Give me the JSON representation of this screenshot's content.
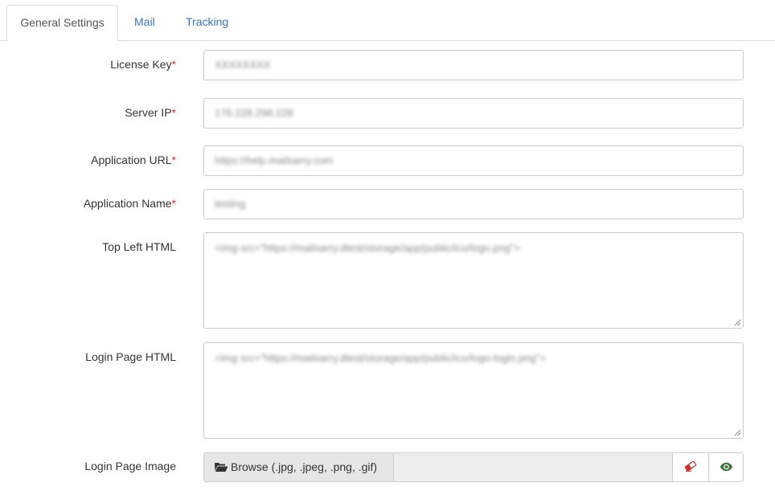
{
  "tabs": [
    {
      "label": "General Settings",
      "active": true
    },
    {
      "label": "Mail",
      "active": false
    },
    {
      "label": "Tracking",
      "active": false
    }
  ],
  "fields": {
    "license_key": {
      "label": "License Key",
      "required": "*",
      "value": "XXXXXXXX"
    },
    "server_ip": {
      "label": "Server IP",
      "required": "*",
      "value": "176.228.298.228"
    },
    "application_url": {
      "label": "Application URL",
      "required": "*",
      "value": "https://help.mailsarry.com"
    },
    "application_name": {
      "label": "Application Name",
      "required": "*",
      "value": "testing"
    },
    "top_left_html": {
      "label": "Top Left HTML",
      "value": "<img src=\"https://mailsarry.dtest/storage/app/public/ico/logo.png\">"
    },
    "login_page_html": {
      "label": "Login Page HTML",
      "value": "<img src=\"https://mailsarry.dtest/storage/app/public/ico/logo-login.png\">"
    },
    "login_page_image": {
      "label": "Login Page Image",
      "browse_label": "Browse (.jpg, .jpeg, .png, .gif)"
    }
  },
  "icons": {
    "browse": "folder-open-icon",
    "clear": "eraser-icon",
    "preview": "eye-icon"
  },
  "colors": {
    "tab_link": "#3b73b9",
    "required": "#cc3333",
    "eraser": "#c9302c",
    "eye": "#3c763d"
  }
}
